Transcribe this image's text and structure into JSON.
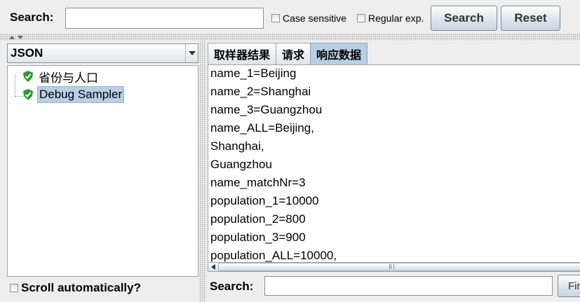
{
  "top_search": {
    "label": "Search:",
    "value": "",
    "case_sensitive_label": "Case sensitive",
    "regex_label": "Regular exp.",
    "search_button": "Search",
    "reset_button": "Reset"
  },
  "left_panel": {
    "renderer_selected": "JSON",
    "tree": [
      {
        "label": "省份与人口",
        "icon": "check-shield-icon",
        "selected": false
      },
      {
        "label": "Debug Sampler",
        "icon": "check-shield-icon",
        "selected": true
      }
    ],
    "scroll_auto_label": "Scroll automatically?"
  },
  "right_panel": {
    "tabs": [
      {
        "label": "取样器结果",
        "active": false
      },
      {
        "label": "请求",
        "active": false
      },
      {
        "label": "响应数据",
        "active": true
      }
    ],
    "response_lines": [
      "name_1=Beijing",
      "name_2=Shanghai",
      "name_3=Guangzhou",
      "name_ALL=Beijing,",
      "Shanghai,",
      "Guangzhou",
      "name_matchNr=3",
      "population_1=10000",
      "population_2=800",
      "population_3=900",
      "population_ALL=10000,"
    ],
    "bottom_search_label": "Search:",
    "bottom_search_value": "",
    "find_button": "Fir"
  },
  "colors": {
    "icon_green": "#2e9a2e",
    "selection": "#b8cfe5",
    "active_tab": "#b9cee3"
  }
}
